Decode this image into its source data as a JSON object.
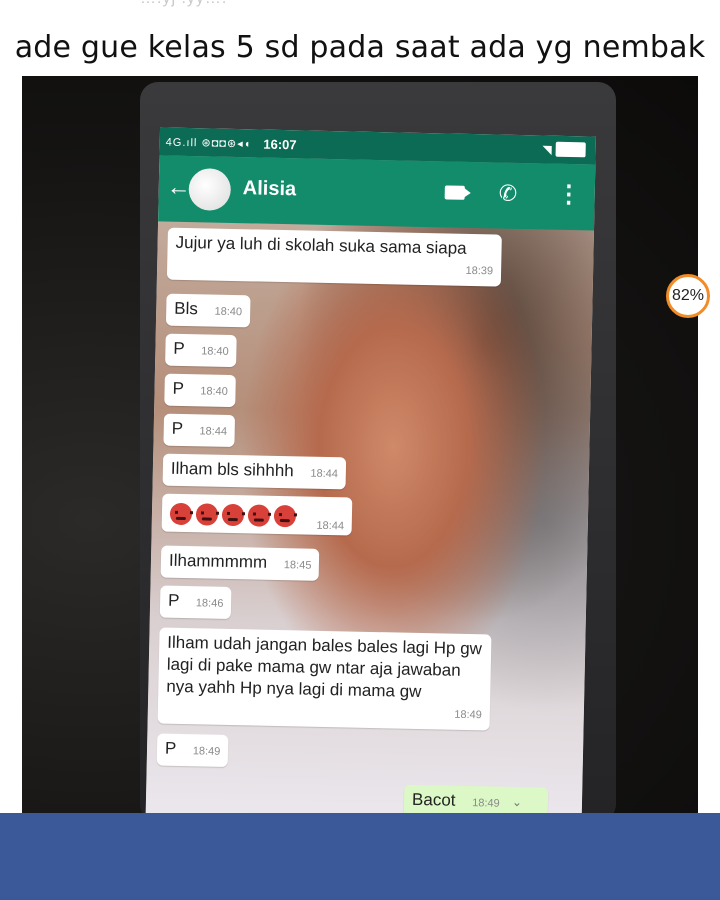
{
  "post": {
    "ghost_header": "….yj  .yy….",
    "caption": "ade gue kelas 5 sd pada saat ada yg nembak"
  },
  "phone": {
    "status": {
      "icons": "4G.ıll ⊛◘◘⊛◂◖",
      "time": "16:07"
    },
    "chat": {
      "contact_name": "Alisia",
      "back_icon": "←",
      "call_icon": "✆",
      "menu_icon": "⋮"
    },
    "messages": [
      {
        "text": "Jujur ya luh di skolah suka sama siapa",
        "time": "18:39",
        "direction": "in"
      },
      {
        "text": "Bls",
        "time": "18:40",
        "direction": "in"
      },
      {
        "text": "P",
        "time": "18:40",
        "direction": "in"
      },
      {
        "text": "P",
        "time": "18:40",
        "direction": "in"
      },
      {
        "text": "P",
        "time": "18:44",
        "direction": "in"
      },
      {
        "text": "Ilham bls sihhhh",
        "time": "18:44",
        "direction": "in"
      },
      {
        "text": "",
        "emoji": "angry-face x5",
        "time": "18:44",
        "direction": "in"
      },
      {
        "text": "Ilhammmmm",
        "time": "18:45",
        "direction": "in"
      },
      {
        "text": "P",
        "time": "18:46",
        "direction": "in"
      },
      {
        "text": "Ilham udah  jangan bales bales lagi Hp gw lagi di pake mama gw ntar aja jawaban  nya yahh Hp nya lagi di mama gw",
        "time": "18:49",
        "direction": "in"
      },
      {
        "text": "P",
        "time": "18:49",
        "direction": "in"
      },
      {
        "text": "Bacot",
        "time": "18:49",
        "direction": "out"
      }
    ]
  },
  "overlay": {
    "progress_badge": "82%"
  },
  "colors": {
    "whatsapp_dark": "#0b6b55",
    "whatsapp_primary": "#128c6b",
    "bubble_out": "#dcf8c6",
    "facebook_blue": "#3b5998",
    "badge_ring": "#f28c28"
  }
}
